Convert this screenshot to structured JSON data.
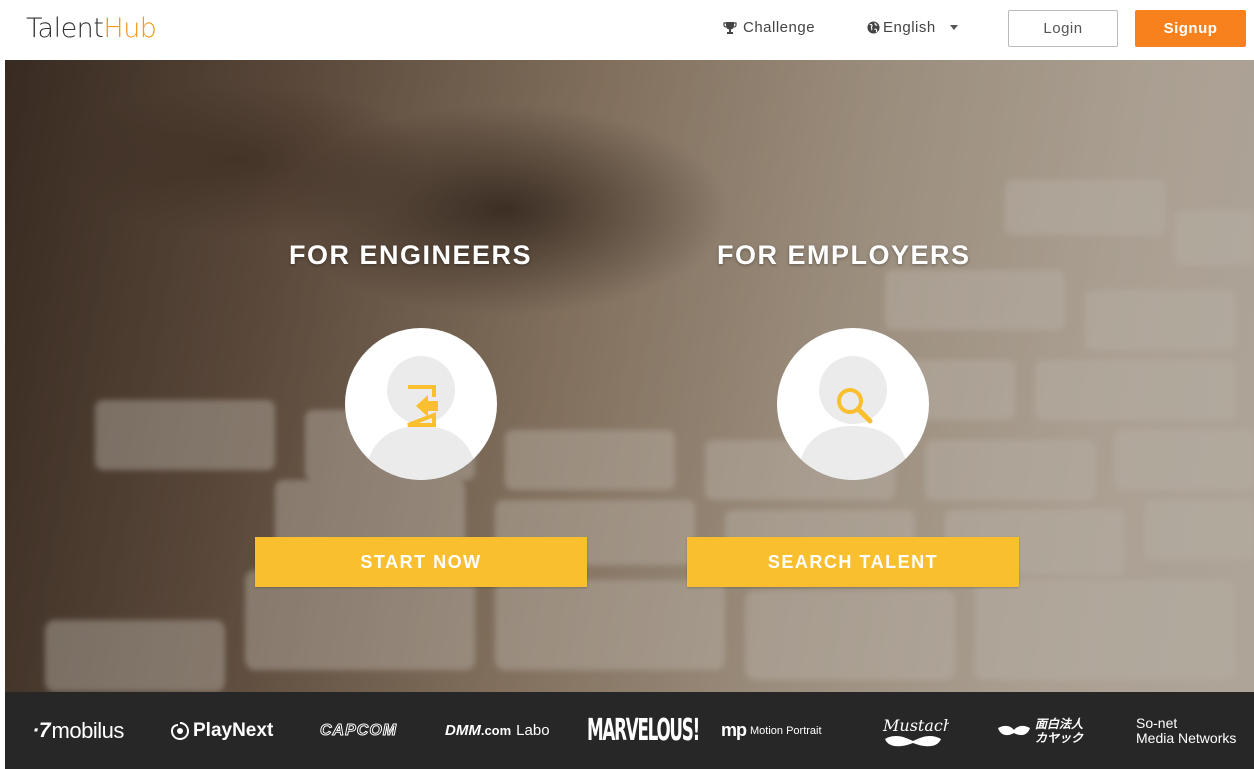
{
  "header": {
    "logo_part1": "Talent",
    "logo_part2": "Hub",
    "challenge_label": "Challenge",
    "language_label": "English",
    "login_label": "Login",
    "signup_label": "Signup"
  },
  "hero": {
    "engineers": {
      "title": "FOR ENGINEERS",
      "cta": "START NOW",
      "icon": "login-arrow-icon"
    },
    "employers": {
      "title": "FOR EMPLOYERS",
      "cta": "SEARCH TALENT",
      "icon": "magnifier-icon"
    }
  },
  "sponsors": {
    "mobilus": "mobilus",
    "playnext": "PlayNext",
    "capcom": "CAPCOM",
    "dmm_a": "DMM",
    "dmm_b": ".com",
    "dmm_c": "Labo",
    "marvelous": "MARVELOUS!",
    "mp_a": "mp",
    "mp_b": "Motion Portrait",
    "kayac_a": "面白法人",
    "kayac_b": "カヤック",
    "sonet_a": "So-net",
    "sonet_b": "Media Networks"
  },
  "colors": {
    "accent_orange": "#f7811d",
    "logo_hub": "#f29a1e",
    "cta_yellow": "#f9bf2f",
    "icon_yellow": "#f9bf2f",
    "sponsor_strip": "#272727"
  }
}
